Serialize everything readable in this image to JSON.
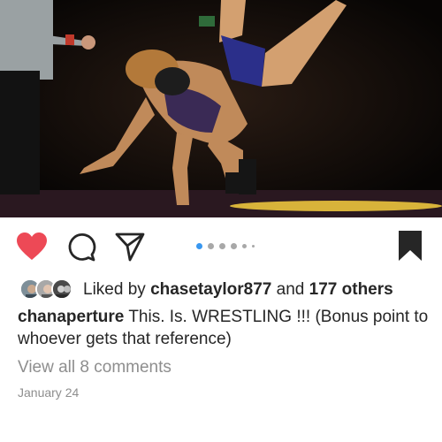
{
  "post": {
    "photo": {
      "subject": "wrestling-match-photo"
    },
    "actions": {
      "like_state": "liked",
      "like_color": "#ed4956",
      "like_icon": "heart-icon",
      "comment_icon": "comment-bubble-icon",
      "share_icon": "paper-plane-icon",
      "save_icon": "bookmark-icon",
      "save_state": "saved"
    },
    "carousel": {
      "total_indicators": 5,
      "active_index": 0,
      "active_color": "#3897f0"
    },
    "likes": {
      "prefix": "Liked by",
      "first_user": "chasetaylor877",
      "connector": "and",
      "others": "177 others"
    },
    "caption": {
      "username": "chanaperture",
      "text": "This. Is. WRESTLING !!! (Bonus point to whoever gets that reference)"
    },
    "comments_link": "View all 8 comments",
    "date": "January 24"
  }
}
